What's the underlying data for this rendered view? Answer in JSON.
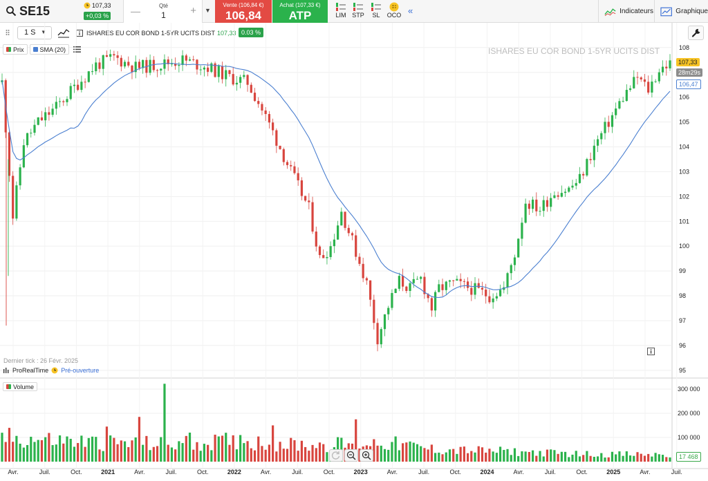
{
  "header": {
    "ticker": "SE15",
    "last_price": "107,33",
    "change": "+0,03 %",
    "qty_label": "Qté",
    "qty_value": "1",
    "sell_label": "Vente (106,84 €)",
    "sell_price": "106,84",
    "buy_label": "Achat (107,33 €)",
    "buy_price": "ATP",
    "order_types": [
      "LIM",
      "STP",
      "SL",
      "OCO"
    ],
    "indicators_label": "Indicateurs",
    "chart_label": "Graphique"
  },
  "toolbar": {
    "interval": "1 S",
    "instrument": "ISHARES EU COR BOND 1-5YR UCITS DIST",
    "instrument_price": "107,33",
    "instrument_change": "0.03 %"
  },
  "legend": {
    "price": "Prix",
    "sma": "SMA (20)",
    "volume": "Volume"
  },
  "footer": {
    "last_tick": "Dernier tick : 26 Févr. 2025",
    "source": "ProRealTime",
    "session": "Pré-ouverture"
  },
  "badges": {
    "last": "107,33",
    "timer": "28m29s",
    "sma": "106,47",
    "volume": "17 468"
  },
  "colors": {
    "up": "#2bb24c",
    "down": "#d8453e",
    "sma": "#4a7fd0",
    "last": "#f7c325"
  },
  "chart_data": {
    "type": "candlestick",
    "title": "ISHARES EU COR BOND 1-5YR UCITS DIST",
    "y_ticks": [
      95,
      96,
      97,
      98,
      99,
      100,
      101,
      102,
      103,
      104,
      105,
      106,
      107,
      108
    ],
    "ylim": [
      94.8,
      108.3
    ],
    "x_ticks": [
      "Avr.",
      "Juil.",
      "Oct.",
      "2021",
      "Avr.",
      "Juil.",
      "Oct.",
      "2022",
      "Avr.",
      "Juil.",
      "Oct.",
      "2023",
      "Avr.",
      "Juil.",
      "Oct.",
      "2024",
      "Avr.",
      "Juil.",
      "Oct.",
      "2025",
      "Avr.",
      "Juil."
    ],
    "volume_ticks": [
      "100 000",
      "200 000",
      "300 000"
    ],
    "volume_ylim": [
      0,
      340000
    ],
    "price_path": [
      [
        0,
        106.6
      ],
      [
        3,
        101.2
      ],
      [
        6,
        104.2
      ],
      [
        10,
        105.0
      ],
      [
        15,
        105.6
      ],
      [
        20,
        106.4
      ],
      [
        26,
        107.3
      ],
      [
        31,
        107.6
      ],
      [
        37,
        107.2
      ],
      [
        43,
        107.3
      ],
      [
        50,
        107.5
      ],
      [
        57,
        107.2
      ],
      [
        63,
        106.8
      ],
      [
        68,
        106.6
      ],
      [
        71,
        105.8
      ],
      [
        75,
        104.6
      ],
      [
        80,
        103.0
      ],
      [
        85,
        101.5
      ],
      [
        88,
        99.5
      ],
      [
        91,
        100.0
      ],
      [
        94,
        101.4
      ],
      [
        97,
        100.2
      ],
      [
        101,
        98.5
      ],
      [
        104,
        96.3
      ],
      [
        107,
        97.6
      ],
      [
        110,
        98.6
      ],
      [
        113,
        98.3
      ],
      [
        116,
        98.7
      ],
      [
        119,
        97.5
      ],
      [
        121,
        98.3
      ],
      [
        125,
        98.5
      ],
      [
        130,
        98.3
      ],
      [
        135,
        98.0
      ],
      [
        139,
        98.3
      ],
      [
        142,
        99.7
      ],
      [
        145,
        101.8
      ],
      [
        149,
        101.5
      ],
      [
        153,
        102.2
      ],
      [
        157,
        102.3
      ],
      [
        160,
        102.7
      ],
      [
        164,
        104.0
      ],
      [
        168,
        105.0
      ],
      [
        172,
        106.0
      ],
      [
        176,
        106.8
      ],
      [
        179,
        106.3
      ],
      [
        182,
        107.1
      ],
      [
        184,
        107.3
      ]
    ],
    "volume_profile": [
      [
        0,
        100000
      ],
      [
        25,
        80000
      ],
      [
        45,
        72000
      ],
      [
        65,
        85000
      ],
      [
        80,
        70000
      ],
      [
        95,
        72000
      ],
      [
        105,
        80000
      ],
      [
        120,
        50000
      ],
      [
        140,
        42000
      ],
      [
        160,
        32000
      ],
      [
        185,
        28000
      ]
    ],
    "volume_spikes": [
      [
        45,
        322000
      ],
      [
        38,
        185000
      ],
      [
        98,
        175000
      ],
      [
        75,
        150000
      ],
      [
        29,
        145000
      ],
      [
        52,
        120000
      ],
      [
        66,
        110000
      ]
    ],
    "sma_period": 20,
    "last_value": 107.33,
    "sma_last": 106.47,
    "volume_last": 17468
  }
}
